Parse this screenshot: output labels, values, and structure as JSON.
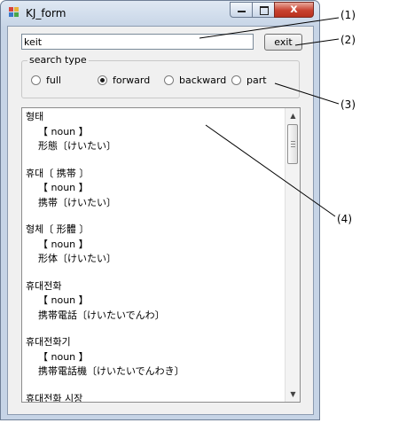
{
  "window": {
    "title": "KJ_form",
    "close_glyph": "x"
  },
  "search": {
    "value": "keit"
  },
  "exit_button": {
    "label": "exit"
  },
  "search_type": {
    "label": "search type",
    "options": [
      {
        "label": "full",
        "selected": false
      },
      {
        "label": "forward",
        "selected": true
      },
      {
        "label": "backward",
        "selected": false
      },
      {
        "label": "part",
        "selected": false
      }
    ]
  },
  "results": [
    {
      "headword": "형태",
      "pos": "【 noun 】",
      "translation": "形態〔けいたい〕"
    },
    {
      "headword": "휴대〔 携帯 〕",
      "pos": "【 noun 】",
      "translation": "携帯〔けいたい〕"
    },
    {
      "headword": "형체〔 形體 〕",
      "pos": "【 noun 】",
      "translation": "形体〔けいたい〕"
    },
    {
      "headword": "휴대전화",
      "pos": "【 noun 】",
      "translation": "携帯電話〔けいたいでんわ〕"
    },
    {
      "headword": "휴대전화기",
      "pos": "【 noun 】",
      "translation": "携帯電話機〔けいたいでんわき〕"
    },
    {
      "headword": "휴대전화 시장",
      "pos": "",
      "translation": ""
    }
  ],
  "scrollbar": {
    "up_glyph": "▲",
    "down_glyph": "▼"
  },
  "callouts": [
    "(1)",
    "(2)",
    "(3)",
    "(4)"
  ],
  "colors": {
    "window_frame": "#c6d4e6",
    "close_button": "#c8412f"
  }
}
